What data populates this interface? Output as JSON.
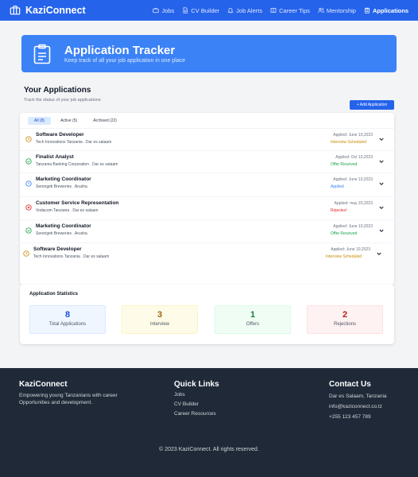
{
  "nav": {
    "brand": "KaziConnect",
    "links": [
      {
        "label": "Jobs",
        "icon": "briefcase-icon"
      },
      {
        "label": "CV Builder",
        "icon": "document-icon"
      },
      {
        "label": "Job Alerts",
        "icon": "bell-icon"
      },
      {
        "label": "Career Tips",
        "icon": "book-icon"
      },
      {
        "label": "Mentorship",
        "icon": "users-icon"
      },
      {
        "label": "Applications",
        "icon": "clipboard-icon",
        "active": true
      }
    ]
  },
  "hero": {
    "title": "Application Tracker",
    "subtitle": "Keep track of all your job application in one place"
  },
  "applications": {
    "title": "Your Applications",
    "subtitle": "Track the status of your job applications",
    "add_button": "+ Add Application",
    "tabs": [
      "All (8)",
      "Active (5)",
      "Archived (22)"
    ],
    "rows": [
      {
        "title": "Software Developer",
        "company": "Tech Innovations Tanzania  .  Dar es salaam",
        "applied": "Applied: June 10,2023",
        "status": "Interview Scheduled",
        "kind": "interview"
      },
      {
        "title": "Finalist Analyst",
        "company": "Tanzania Banking Corporation  .  Dar es salaam",
        "applied": "Applied: Oct 10,2023",
        "status": "Offer Received",
        "kind": "offer"
      },
      {
        "title": "Marketing Coordinator",
        "company": "Serengeti Breweries  .  Arusha",
        "applied": "Applied: June 10,2023",
        "status": "Applied",
        "kind": "applied"
      },
      {
        "title": "Customer Service Representation",
        "company": "Vodacom Tanzania  .  Dar es salaam",
        "applied": "Applied: may 20,2023",
        "status": "Rejected",
        "kind": "rejected"
      },
      {
        "title": "Marketing Coordinator",
        "company": "Serengeti Breweries  .  Arusha",
        "applied": "Applied: June 10,2023",
        "status": "Offer Received",
        "kind": "offer"
      },
      {
        "title": "Software Developer",
        "company": "Tech Innovations Tanzania  .  Dar es salaam",
        "applied": "Applied: June 10,2023",
        "status": "Interview Scheduled",
        "kind": "interview"
      }
    ]
  },
  "statistics": {
    "title": "Application Statistics",
    "boxes": [
      {
        "value": "8",
        "label": "Total Applications"
      },
      {
        "value": "3",
        "label": "Interview"
      },
      {
        "value": "1",
        "label": "Offers"
      },
      {
        "value": "2",
        "label": "Rejections"
      }
    ]
  },
  "colors": {
    "primary": "#2563eb",
    "interview": "#ca8a04",
    "offer": "#16a34a",
    "applied": "#3b82f6",
    "rejected": "#dc2626"
  },
  "footer": {
    "brand": "KaziConnect",
    "tagline": "Empowering young Tanzanians with career Opportunities and development.",
    "quick_links_title": "Quick Links",
    "quick_links": [
      "Jobs",
      "CV Builder",
      "Career Resources"
    ],
    "contact_title": "Contact Us",
    "contact": [
      "Dar es Salaam, Tanzania",
      "info@kaziconnect.co.tz",
      "+255 123 457 789"
    ],
    "copyright": "© 2023 KaziConnect. All rights reserved."
  }
}
